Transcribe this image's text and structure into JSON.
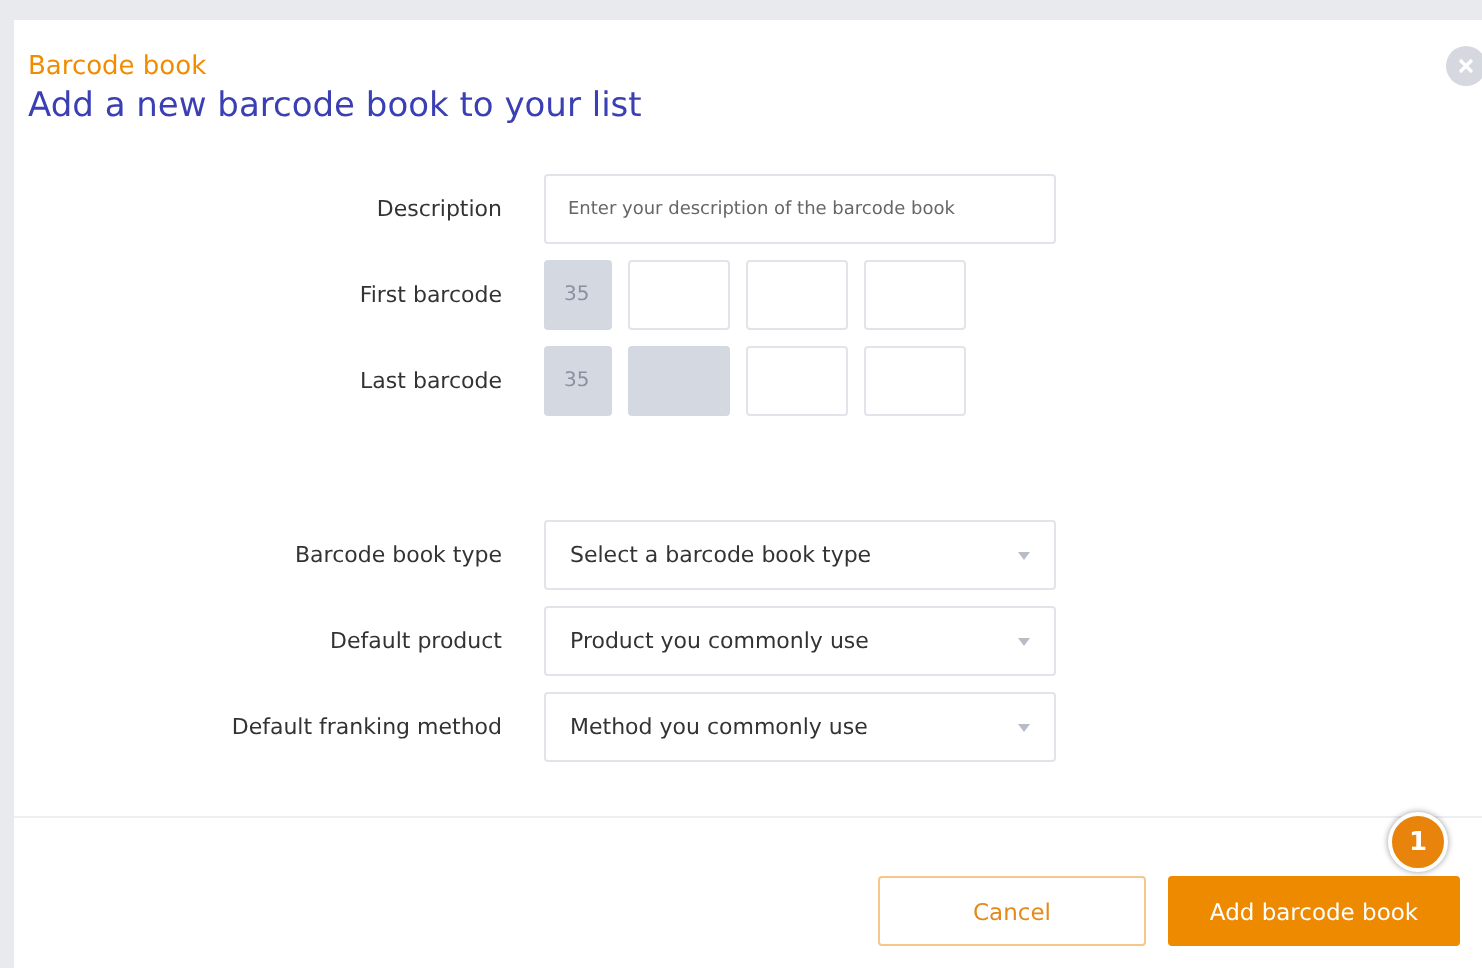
{
  "dialog": {
    "eyebrow": "Barcode book",
    "title": "Add a new barcode book to your list"
  },
  "description": {
    "label": "Description",
    "placeholder": "Enter your description of the barcode book"
  },
  "barcodes": [
    {
      "label": "First barcode",
      "segments": [
        {
          "value": "35",
          "disabled": true
        },
        {
          "disabled": false
        },
        {
          "disabled": false
        },
        {
          "disabled": false
        }
      ]
    },
    {
      "label": "Last barcode",
      "segments": [
        {
          "value": "35",
          "disabled": true
        },
        {
          "disabled": true
        },
        {
          "disabled": false
        },
        {
          "disabled": false
        }
      ]
    }
  ],
  "selects": [
    {
      "label": "Barcode book type",
      "placeholder": "Select a barcode book type"
    },
    {
      "label": "Default product",
      "placeholder": "Product you commonly use"
    },
    {
      "label": "Default franking method",
      "placeholder": "Method you commonly use"
    }
  ],
  "buttons": [
    {
      "label": "Cancel",
      "kind": "secondary"
    },
    {
      "label": "Add barcode book",
      "kind": "primary",
      "badge": "1"
    }
  ]
}
